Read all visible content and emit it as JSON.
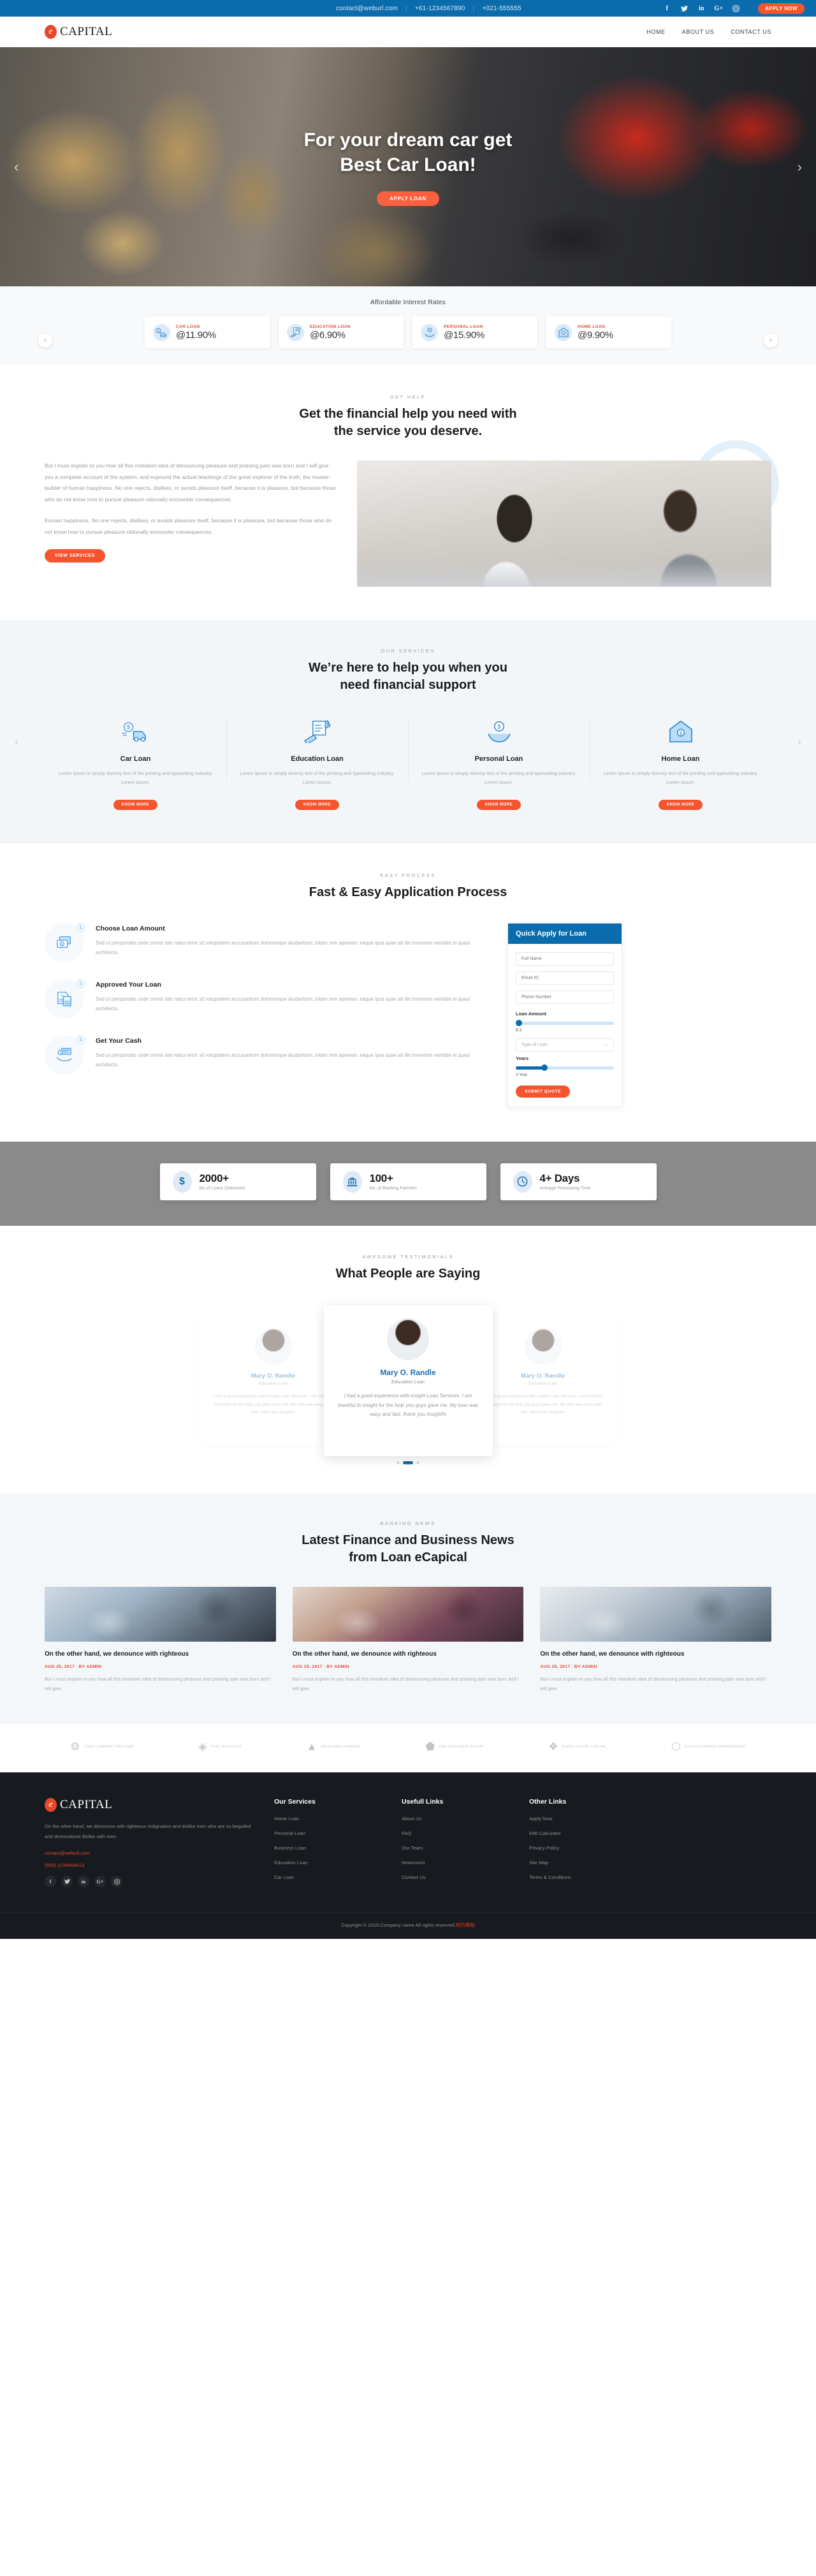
{
  "topbar": {
    "email": "contact@weburl.com",
    "phone1": "+61-1234567890",
    "phone2": "+021-555555",
    "separator": "|",
    "apply_label": "APPLY NOW",
    "social": [
      {
        "name": "facebook-icon",
        "glyph": "f"
      },
      {
        "name": "twitter-icon",
        "glyph": "✈"
      },
      {
        "name": "linkedin-icon",
        "glyph": "in"
      },
      {
        "name": "googleplus-icon",
        "glyph": "G+"
      },
      {
        "name": "instagram-icon",
        "glyph": "◎"
      }
    ]
  },
  "header": {
    "logo_mark": "e",
    "logo_text": "CAPITAL",
    "nav": [
      {
        "label": "HOME"
      },
      {
        "label": "ABOUT US"
      },
      {
        "label": "CONTACT US"
      }
    ]
  },
  "hero": {
    "line1": "For your dream car get",
    "line2": "Best Car Loan!",
    "cta": "APPLY LOAN",
    "prev": "‹",
    "next": "›"
  },
  "rates": {
    "title": "Affordable Interest Rates",
    "prev": "‹",
    "next": "›",
    "items": [
      {
        "label": "CAR LOAN",
        "value": "@11.90%",
        "icon": "car-loan-icon"
      },
      {
        "label": "EDUCATION LOAN",
        "value": "@6.90%",
        "icon": "education-loan-icon"
      },
      {
        "label": "PERSONAL LOAN",
        "value": "@15.90%",
        "icon": "personal-loan-icon"
      },
      {
        "label": "HOME LOAN",
        "value": "@9.90%",
        "icon": "home-loan-icon"
      }
    ]
  },
  "gethelp": {
    "eyebrow": "GET HELP",
    "title_line1": "Get the financial help you need with",
    "title_line2": "the service you deserve.",
    "para1": "But I must explain to you how all this mistaken idea of denouncing pleasure and praising pain was born and I will give you a complete account of the system, and expound the actual teachings of the great explorer of the truth, the master-builder of human happiness. No one rejects, dislikes, or avoids pleasure itself, because it is pleasure, but because those who do not know how to pursue pleasure rationally encounter consequences.",
    "para2": "Euman happiness. No one rejects, dislikes, or avoids pleasure itself, because it is pleasure, but because those who do not know how to pursue pleasure rationally encounter consequences.",
    "cta": "VIEW SERVICES"
  },
  "services": {
    "eyebrow": "OUR SERVICES",
    "title_line1": "We’re here to help you when you",
    "title_line2": "need financial support",
    "prev": "‹",
    "next": "›",
    "items": [
      {
        "name": "Car Loan",
        "desc": "Lorem Ipsum is simply dummy text of the printing and typesetting industry. Lorem Ipsum.",
        "cta": "KNOW MORE",
        "icon": "car-loan-icon"
      },
      {
        "name": "Education Loan",
        "desc": "Lorem Ipsum is simply dummy text of the printing and typesetting industry. Lorem Ipsum.",
        "cta": "KNOW MORE",
        "icon": "education-loan-icon"
      },
      {
        "name": "Personal Loan",
        "desc": "Lorem Ipsum is simply dummy text of the printing and typesetting industry. Lorem Ipsum.",
        "cta": "KNOW MORE",
        "icon": "personal-loan-icon"
      },
      {
        "name": "Home Loan",
        "desc": "Lorem Ipsum is simply dummy text of the printing and typesetting industry. Lorem Ipsum.",
        "cta": "KNOW MORE",
        "icon": "home-loan-icon"
      }
    ]
  },
  "process": {
    "eyebrow": "EASY PROCESS",
    "title": "Fast & Easy Application Process",
    "steps": [
      {
        "num": "1",
        "title": "Choose Loan Amount",
        "desc": "Sed ut perspiciatis unde omnis iste natus error sit voluptatem accusantium doloremque laudantium, totam rem aperiam, eaque ipsa quae ab illo inventore veritatis et quasi architecto."
      },
      {
        "num": "2",
        "title": "Approved Your Loan",
        "desc": "Sed ut perspiciatis unde omnis iste natus error sit voluptatem accusantium doloremque laudantium, totam rem aperiam, eaque ipsa quae ab illo inventore veritatis et quasi architecto."
      },
      {
        "num": "3",
        "title": "Get Your Cash",
        "desc": "Sed ut perspiciatis unde omnis iste natus error sit voluptatem accusantium doloremque laudantium, totam rem aperiam, eaque ipsa quae ab illo inventore veritatis et quasi architecto."
      }
    ],
    "form": {
      "heading": "Quick Apply for Loan",
      "full_name_placeholder": "Full Name",
      "full_name_value": "",
      "email_placeholder": "Email ID",
      "email_value": "",
      "phone_placeholder": "Phone Number",
      "phone_value": "",
      "amount_label": "Loan Amount",
      "amount_value": "$ 3",
      "type_placeholder": "Type of Loan",
      "type_caret": "⌄",
      "years_label": "Years",
      "years_value": "3 Year",
      "submit": "SUBMIT QUOTE"
    }
  },
  "stats": [
    {
      "num": "2000+",
      "label": "No of Loans Disbursed",
      "icon": "dollar-icon",
      "glyph": "$"
    },
    {
      "num": "100+",
      "label": "No. of Banking Partners",
      "icon": "bank-icon",
      "glyph": "\u0001"
    },
    {
      "num": "4+ Days",
      "label": "Average Processing Time",
      "icon": "clock-icon",
      "glyph": "\u0001"
    }
  ],
  "testimonials": {
    "eyebrow": "AWESOME TESTIMONIALS",
    "title": "What People are Saying",
    "items": [
      {
        "name": "Mary O. Randle",
        "role": "Education Loan",
        "quote": "I had a good experience with insight Loan Services. I am thankful to insight for the help you guys gave me. My loan was easy and fast. thank you Insightht"
      },
      {
        "name": "Mary O. Randle",
        "role": "Education Loan",
        "quote": "I had a good experience with insight Loan Services. I am thankful to insight for the help you guys gave me. My loan was easy and fast. thank you Insightht"
      },
      {
        "name": "Mary O. Randle",
        "role": "Education Loan",
        "quote": "I had a good experience with insight Loan Services. I am thankful to insight for the help you guys gave me. My loan was easy and fast. thank you Insightht"
      }
    ]
  },
  "news": {
    "eyebrow": "BANKING NEWS",
    "title_line1": "Latest Finance and Business News",
    "title_line2": "from Loan eCapical",
    "items": [
      {
        "title": "On the other hand, we denounce with righteous",
        "date": "AUG 25, 2017",
        "sep": "|",
        "author": "BY ADMIN",
        "desc": "But I must explain to you how all this mistaken idea of denouncing pleasure and praising pain was born and I will give."
      },
      {
        "title": "On the other hand, we denounce with righteous",
        "date": "AUG 25, 2017",
        "sep": "|",
        "author": "BY ADMIN",
        "desc": "But I must explain to you how all this mistaken idea of denouncing pleasure and praising pain was born and I will give."
      },
      {
        "title": "On the other hand, we denounce with righteous",
        "date": "AUG 25, 2017",
        "sep": "|",
        "author": "BY ADMIN",
        "desc": "But I must explain to you how all this mistaken idea of denouncing pleasure and praising pain was born and I will give."
      }
    ]
  },
  "partners": [
    {
      "glyph": "⚙",
      "text": "LOAN COMPANY\nPARTNER"
    },
    {
      "glyph": "◈",
      "text": "FOAL\nINVESTOR"
    },
    {
      "glyph": "▲",
      "text": "MAGLANER\nFINANCE"
    },
    {
      "glyph": "⬟",
      "text": "ONE PROVIDER\nGROUP"
    },
    {
      "glyph": "❖",
      "text": "PLACE HOUSE\nCAPITAL"
    },
    {
      "glyph": "⬡",
      "text": "EXTRA COMPANY\nPARTNERSHIP"
    }
  ],
  "footer": {
    "logo_mark": "e",
    "logo_text": "CAPITAL",
    "about": "On the other hand, we denounce with righteous indignation and dislike men who are so beguiled and demoralized dislike with men.",
    "email": "contact@weburl.com",
    "phone": "(555) 1234564513",
    "social": [
      {
        "name": "facebook-icon",
        "glyph": "f"
      },
      {
        "name": "twitter-icon",
        "glyph": "✈"
      },
      {
        "name": "linkedin-icon",
        "glyph": "in"
      },
      {
        "name": "googleplus-icon",
        "glyph": "G+"
      },
      {
        "name": "instagram-icon",
        "glyph": "◎"
      }
    ],
    "columns": [
      {
        "heading": "Our Services",
        "links": [
          "Home Loan",
          "Personal Loan",
          "Business Loan",
          "Education Loan",
          "Car Loan"
        ]
      },
      {
        "heading": "Usefull Links",
        "links": [
          "About Us",
          "FAQ",
          "Our Team",
          "Newsroom",
          "Contact Us"
        ]
      },
      {
        "heading": "Other Links",
        "links": [
          "Apply Now",
          "EMI Calculator",
          "Privacy Policy",
          "Site Map",
          "Terms & Conditions"
        ]
      }
    ],
    "copyright_prefix": "Copyright © 2019.Company name All rights reserved.",
    "copyright_cn": "网页模板"
  }
}
